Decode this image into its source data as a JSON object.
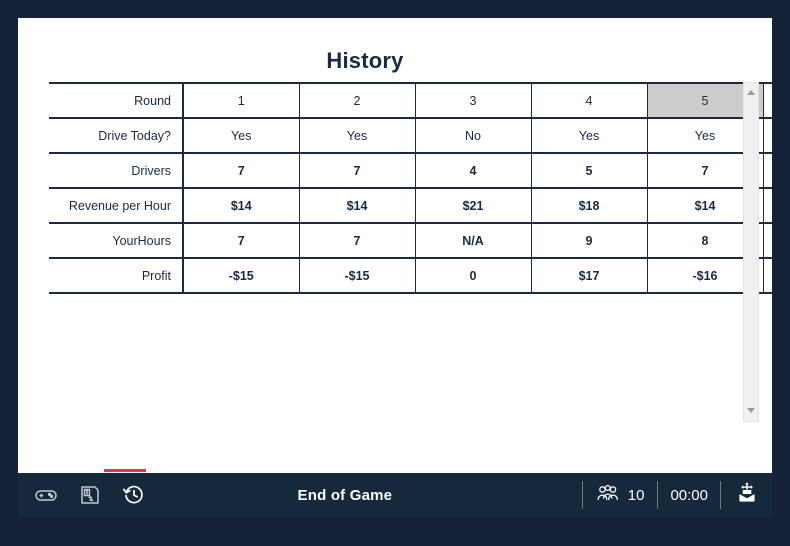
{
  "page": {
    "title": "History"
  },
  "chart_data": {
    "type": "table",
    "title": "History",
    "row_labels": [
      "Round",
      "Drive Today?",
      "Drivers",
      "Revenue per Hour",
      "YourHours",
      "Profit"
    ],
    "categories": [
      "1",
      "2",
      "3",
      "4",
      "5"
    ],
    "highlighted_column_index": 4,
    "rows": [
      {
        "label": "Round",
        "kind": "header",
        "values": [
          "1",
          "2",
          "3",
          "4",
          "5"
        ]
      },
      {
        "label": "Drive Today?",
        "kind": "text",
        "values": [
          "Yes",
          "Yes",
          "No",
          "Yes",
          "Yes"
        ]
      },
      {
        "label": "Drivers",
        "kind": "value",
        "values": [
          "7",
          "7",
          "4",
          "5",
          "7"
        ]
      },
      {
        "label": "Revenue per Hour",
        "kind": "value",
        "values": [
          "$14",
          "$14",
          "$21",
          "$18",
          "$14"
        ]
      },
      {
        "label": "YourHours",
        "kind": "value",
        "values": [
          "7",
          "7",
          "N/A",
          "9",
          "8"
        ]
      },
      {
        "label": "Profit",
        "kind": "value",
        "values": [
          "-$15",
          "-$15",
          "0",
          "$17",
          "-$16"
        ]
      }
    ],
    "series": [
      {
        "name": "Drivers",
        "values": [
          7,
          7,
          4,
          5,
          7
        ]
      },
      {
        "name": "Revenue per Hour",
        "values": [
          14,
          14,
          21,
          18,
          14
        ]
      },
      {
        "name": "YourHours",
        "values": [
          7,
          7,
          null,
          9,
          8
        ]
      },
      {
        "name": "Profit",
        "values": [
          -15,
          -15,
          0,
          17,
          -16
        ]
      }
    ],
    "xlabel": "Round",
    "ylabel": "",
    "grid": true,
    "legend": "none"
  },
  "scrollbar": {
    "up_icon": "scroll-up-arrow-icon",
    "down_icon": "scroll-down-arrow-icon"
  },
  "toolbar": {
    "tabs": [
      {
        "name": "game",
        "icon": "gamepad-icon",
        "active": false
      },
      {
        "name": "instructions",
        "icon": "instructions-icon",
        "active": false
      },
      {
        "name": "history",
        "icon": "history-clock-icon",
        "active": true
      }
    ],
    "status": "End of Game",
    "players_icon": "people-group-icon",
    "players_count": "10",
    "timer": "00:00",
    "brand_icon": "moblab-logo-icon",
    "active_indicator_color": "#e8344e"
  },
  "colors": {
    "frame": "#152238",
    "toolbar": "#16293c",
    "panel": "#ffffff",
    "table_border": "#1b2a42",
    "text": "#1b2a42",
    "highlight": "#cccccc",
    "accent": "#e8344e"
  }
}
